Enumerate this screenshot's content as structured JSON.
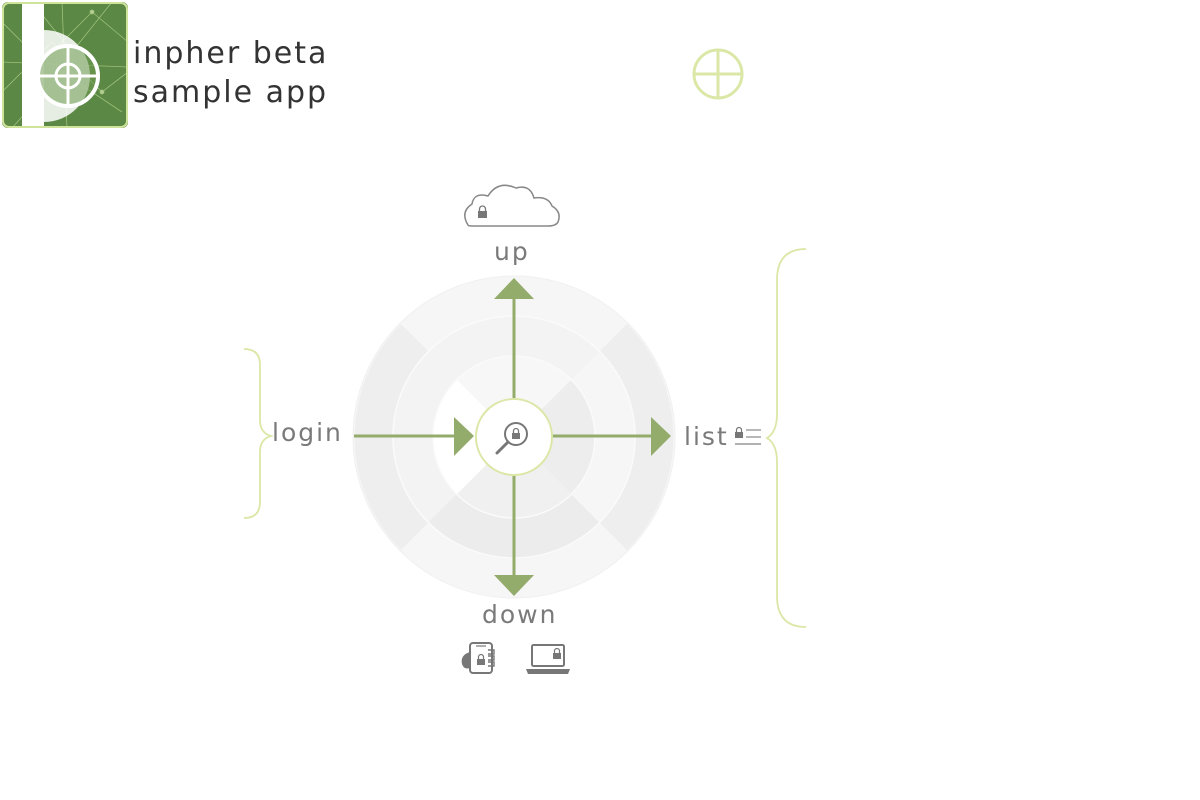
{
  "header": {
    "title_line1": "inpher beta",
    "title_line2": "sample app"
  },
  "diagram": {
    "up_label": "up",
    "down_label": "down",
    "login_label": "login",
    "list_label": "list"
  },
  "colors": {
    "accent_green": "#93ab6b",
    "light_green": "#dbe7a6",
    "ring_light": "#f6f6f6",
    "ring_mid": "#eeeeee",
    "icon_gray": "#777777",
    "text_gray": "#7a7a7a",
    "title_dark": "#333333"
  },
  "icons": {
    "logo": "inpher-logo-icon",
    "target": "crosshair-icon",
    "cloud": "cloud-lock-icon",
    "search": "search-lock-icon",
    "list": "list-lock-icon",
    "phone": "phone-lock-icon",
    "laptop": "laptop-lock-icon"
  }
}
